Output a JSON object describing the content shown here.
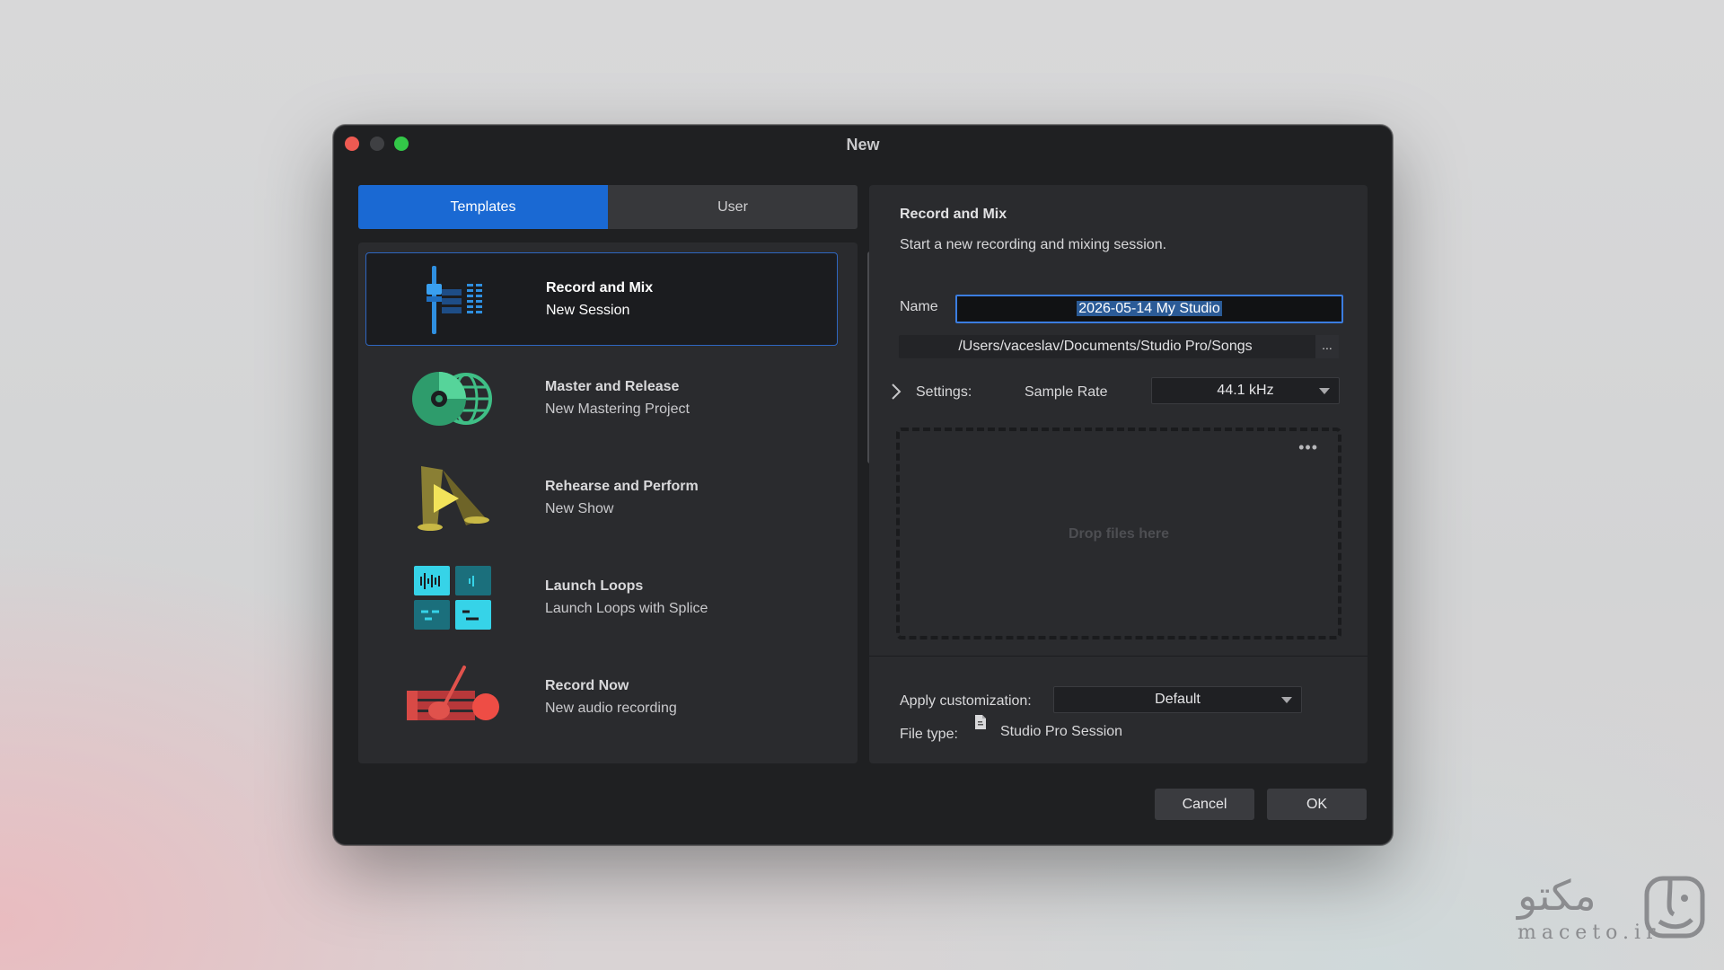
{
  "window": {
    "title": "New"
  },
  "tabs": [
    {
      "label": "Templates",
      "active": true
    },
    {
      "label": "User",
      "active": false
    }
  ],
  "templates": [
    {
      "title": "Record and Mix",
      "subtitle": "New Session",
      "icon": "mixer-fader-icon",
      "selected": true
    },
    {
      "title": "Master and Release",
      "subtitle": "New Mastering Project",
      "icon": "disc-globe-icon",
      "selected": false
    },
    {
      "title": "Rehearse and Perform",
      "subtitle": "New Show",
      "icon": "stage-play-icon",
      "selected": false
    },
    {
      "title": "Launch Loops",
      "subtitle": "Launch Loops with Splice",
      "icon": "loop-grid-icon",
      "selected": false
    },
    {
      "title": "Record Now",
      "subtitle": "New audio recording",
      "icon": "guitar-record-icon",
      "selected": false
    }
  ],
  "details": {
    "title": "Record and Mix",
    "description": "Start a new recording and mixing session.",
    "name_label": "Name",
    "name_value": "2026-05-14 My Studio",
    "path": "/Users/vaceslav/Documents/Studio Pro/Songs",
    "path_button": "...",
    "settings_label": "Settings:",
    "sample_rate_label": "Sample Rate",
    "sample_rate_value": "44.1 kHz",
    "drop_text": "Drop files here",
    "drop_more": "•••",
    "customization_label": "Apply customization:",
    "customization_value": "Default",
    "filetype_label": "File type:",
    "filetype_value": "Studio Pro Session"
  },
  "buttons": {
    "cancel": "Cancel",
    "ok": "OK"
  },
  "watermark": {
    "arabic": "مکتو",
    "latin": "maceto.ir"
  },
  "colors": {
    "accent": "#1a69d3",
    "window_bg": "#1f2022",
    "panel_bg": "#2a2b2e"
  }
}
